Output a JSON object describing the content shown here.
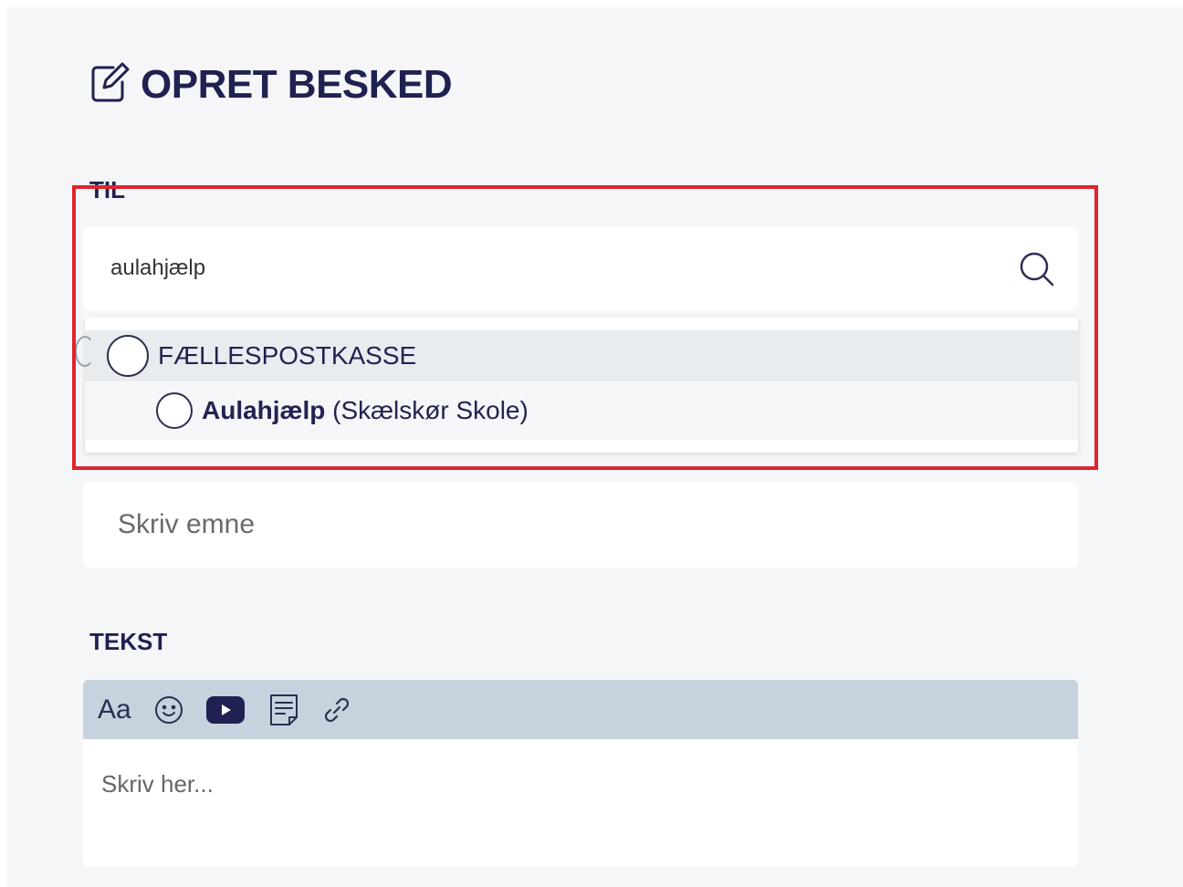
{
  "header": {
    "title": "OPRET BESKED",
    "icon": "edit-icon"
  },
  "recipients": {
    "label": "TIL",
    "search_value": "aulahjælp",
    "search_icon": "search-icon",
    "dropdown": {
      "group_label": "FÆLLESPOSTKASSE",
      "items": [
        {
          "name": "Aulahjælp",
          "detail": "(Skælskør Skole)"
        }
      ]
    }
  },
  "subject": {
    "placeholder": "Skriv emne"
  },
  "text_section": {
    "label": "TEKST",
    "toolbar": {
      "font_button": "Aa",
      "icons": [
        "emoji-icon",
        "youtube-icon",
        "document-icon",
        "link-icon"
      ]
    },
    "editor_placeholder": "Skriv her..."
  },
  "colors": {
    "title": "#1f2150",
    "highlight_border": "#e0242d",
    "toolbar_bg": "#c6d3de",
    "panel_bg": "#f5f6f8"
  }
}
